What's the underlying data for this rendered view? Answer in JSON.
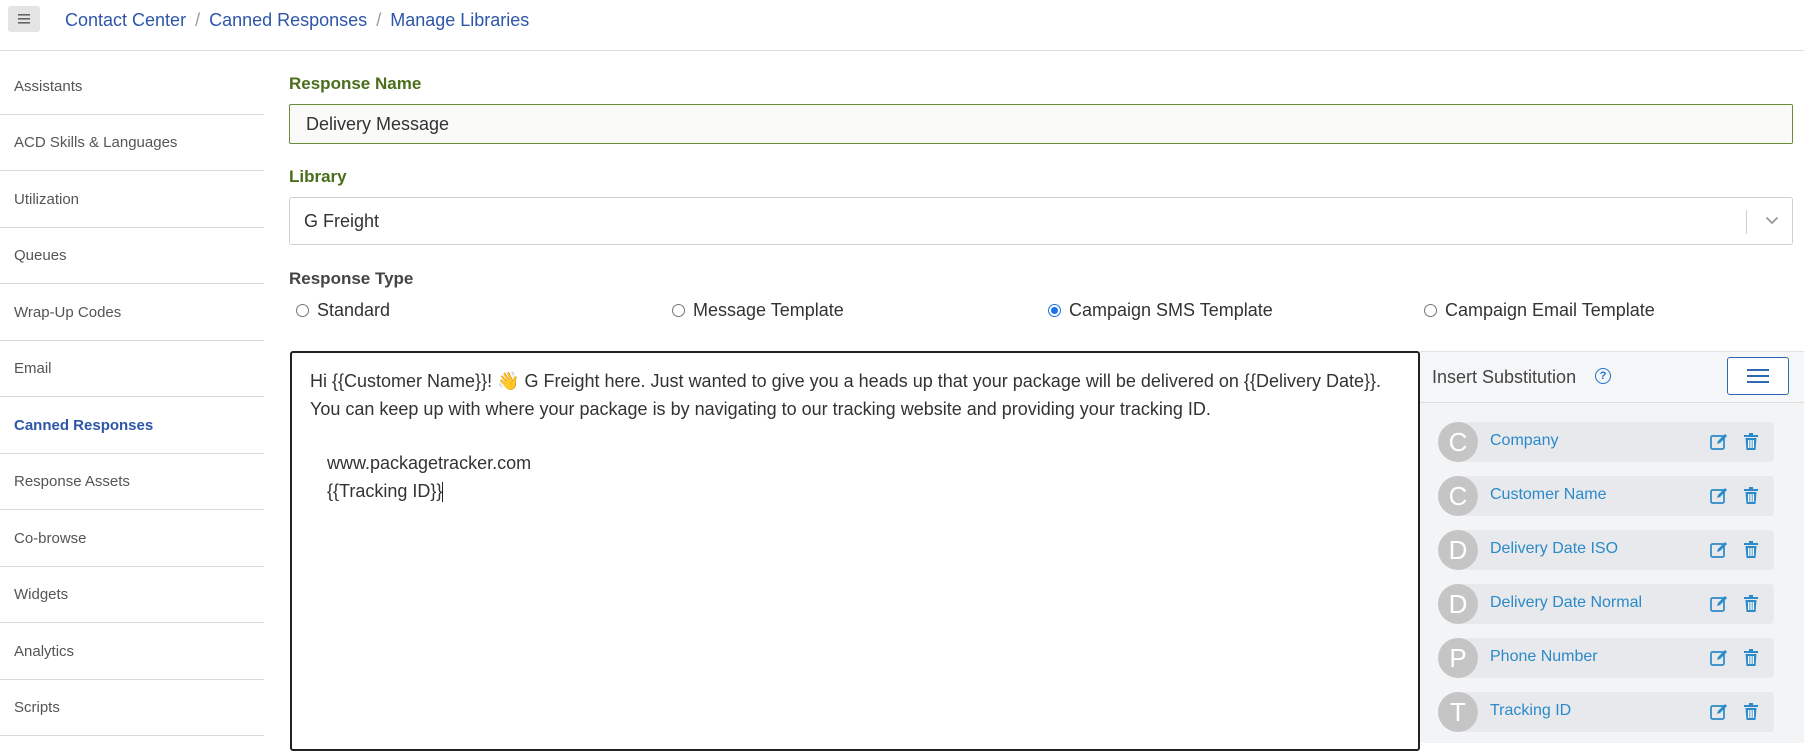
{
  "breadcrumb": [
    "Contact Center",
    "Canned Responses",
    "Manage Libraries"
  ],
  "sidebar": {
    "items": [
      {
        "label": "Assistants"
      },
      {
        "label": "ACD Skills & Languages"
      },
      {
        "label": "Utilization"
      },
      {
        "label": "Queues"
      },
      {
        "label": "Wrap-Up Codes"
      },
      {
        "label": "Email"
      },
      {
        "label": "Canned Responses",
        "active": true
      },
      {
        "label": "Response Assets"
      },
      {
        "label": "Co-browse"
      },
      {
        "label": "Widgets"
      },
      {
        "label": "Analytics"
      },
      {
        "label": "Scripts"
      }
    ]
  },
  "form": {
    "response_name_label": "Response Name",
    "response_name_value": "Delivery Message",
    "library_label": "Library",
    "library_value": "G Freight",
    "response_type_label": "Response Type",
    "response_types": [
      {
        "label": "Standard",
        "checked": false
      },
      {
        "label": "Message Template",
        "checked": false
      },
      {
        "label": "Campaign SMS Template",
        "checked": true
      },
      {
        "label": "Campaign Email Template",
        "checked": false
      }
    ]
  },
  "editor": {
    "paragraph": "Hi {{Customer Name}}! 👋 G Freight here. Just wanted to give you a heads up that your package will be delivered on {{Delivery Date}}. You can keep up with where your package is by navigating to our tracking website and providing your tracking ID.",
    "line_url": "www.packagetracker.com",
    "line_tracking": "{{Tracking ID}}"
  },
  "substitutions": {
    "title": "Insert Substitution",
    "items": [
      {
        "initial": "C",
        "label": "Company"
      },
      {
        "initial": "C",
        "label": "Customer Name"
      },
      {
        "initial": "D",
        "label": "Delivery Date ISO"
      },
      {
        "initial": "D",
        "label": "Delivery Date Normal"
      },
      {
        "initial": "P",
        "label": "Phone Number"
      },
      {
        "initial": "T",
        "label": "Tracking ID"
      }
    ]
  },
  "colors": {
    "link_blue": "#2e56a8",
    "label_green": "#4a6e1c",
    "substitution_blue": "#2b8ac7",
    "radio_blue": "#1a73e8"
  },
  "icons": [
    "hamburger-icon",
    "chevron-down-icon",
    "help-icon",
    "list-icon",
    "edit-icon",
    "trash-icon"
  ]
}
